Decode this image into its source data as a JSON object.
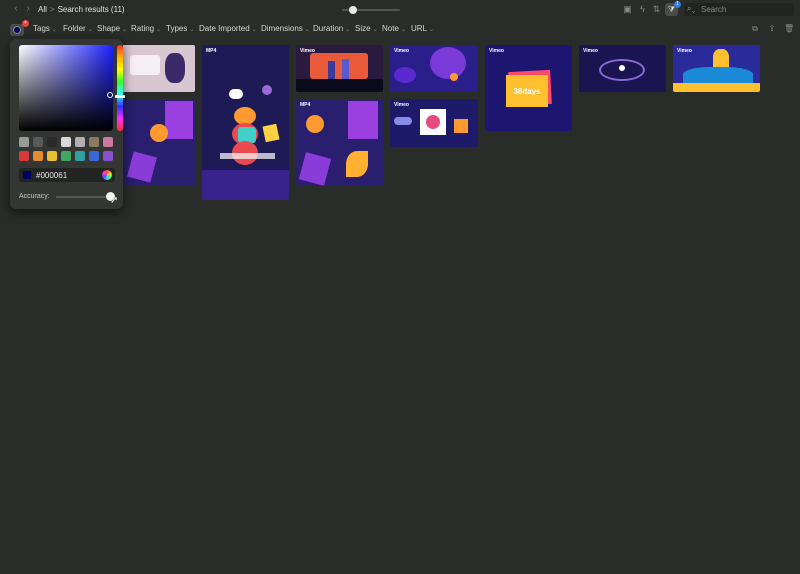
{
  "topbar": {
    "breadcrumb_root": "All",
    "breadcrumb_sep": ">",
    "breadcrumb_current": "Search results (11)",
    "filter_badge": "1",
    "search_placeholder": "Search"
  },
  "filters": {
    "color_value": "#000061",
    "chips": [
      "Tags",
      "Folder",
      "Shape",
      "Rating",
      "Types",
      "Date Imported",
      "Dimensions",
      "Duration",
      "Size",
      "Note",
      "URL"
    ]
  },
  "thumbnails": [
    {
      "label": ""
    },
    {
      "label": "MP4"
    },
    {
      "label": "Vimeo"
    },
    {
      "label": "Vimeo"
    },
    {
      "label": "Vimeo"
    },
    {
      "label": "Vimeo"
    },
    {
      "label": "Vimeo"
    },
    {
      "label": ""
    },
    {
      "label": "MP4"
    },
    {
      "label": "Vimeo"
    }
  ],
  "thumb_text": {
    "days": "36days"
  },
  "picker": {
    "hex": "#000061",
    "accuracy_label": "Accuracy:",
    "swatches": [
      "#9a9a9a",
      "#5a5a5a",
      "#2a2a2a",
      "#d8d8d8",
      "#b0b0b0",
      "#8a7a60",
      "#c87aa0",
      "#d83838",
      "#e88a30",
      "#e8c030",
      "#40a860",
      "#30a0a0",
      "#3a68d8",
      "#8a50d0"
    ]
  },
  "colors": {
    "accent": "#2f7be0",
    "selected_color": "#000061",
    "clear": "#e04848"
  }
}
